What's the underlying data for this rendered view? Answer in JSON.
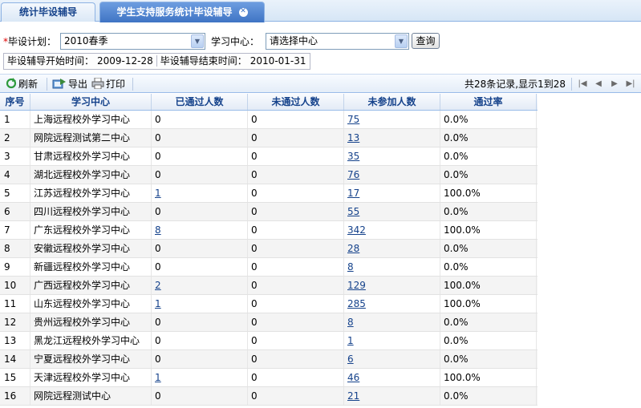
{
  "tabs": [
    {
      "label": "统计毕设辅导",
      "active": false
    },
    {
      "label": "学生支持服务统计毕设辅导",
      "active": true
    }
  ],
  "filters": {
    "plan_required_mark": "*",
    "plan_label": "毕设计划：",
    "plan_value": "2010春季",
    "center_label": "学习中心：",
    "center_value": "请选择中心",
    "query_button": "查询"
  },
  "dates": {
    "start_label": "毕设辅导开始时间：",
    "start_value": "2009-12-28",
    "end_label": "毕设辅导结束时间：",
    "end_value": "2010-01-31"
  },
  "toolbar": {
    "refresh": "刷新",
    "export": "导出",
    "print": "打印",
    "pager_info": "共28条记录,显示1到28"
  },
  "grid": {
    "columns": [
      "序号",
      "学习中心",
      "已通过人数",
      "未通过人数",
      "未参加人数",
      "通过率"
    ],
    "rows": [
      {
        "no": "1",
        "center": "上海远程校外学习中心",
        "passed": "0",
        "failed": "0",
        "absent": "75",
        "rate": "0.0%"
      },
      {
        "no": "2",
        "center": "网院远程测试第二中心",
        "passed": "0",
        "failed": "0",
        "absent": "13",
        "rate": "0.0%"
      },
      {
        "no": "3",
        "center": "甘肃远程校外学习中心",
        "passed": "0",
        "failed": "0",
        "absent": "35",
        "rate": "0.0%"
      },
      {
        "no": "4",
        "center": "湖北远程校外学习中心",
        "passed": "0",
        "failed": "0",
        "absent": "76",
        "rate": "0.0%"
      },
      {
        "no": "5",
        "center": "江苏远程校外学习中心",
        "passed": "1",
        "failed": "0",
        "absent": "17",
        "rate": "100.0%"
      },
      {
        "no": "6",
        "center": "四川远程校外学习中心",
        "passed": "0",
        "failed": "0",
        "absent": "55",
        "rate": "0.0%"
      },
      {
        "no": "7",
        "center": "广东远程校外学习中心",
        "passed": "8",
        "failed": "0",
        "absent": "342",
        "rate": "100.0%"
      },
      {
        "no": "8",
        "center": "安徽远程校外学习中心",
        "passed": "0",
        "failed": "0",
        "absent": "28",
        "rate": "0.0%"
      },
      {
        "no": "9",
        "center": "新疆远程校外学习中心",
        "passed": "0",
        "failed": "0",
        "absent": "8",
        "rate": "0.0%"
      },
      {
        "no": "10",
        "center": "广西远程校外学习中心",
        "passed": "2",
        "failed": "0",
        "absent": "129",
        "rate": "100.0%"
      },
      {
        "no": "11",
        "center": "山东远程校外学习中心",
        "passed": "1",
        "failed": "0",
        "absent": "285",
        "rate": "100.0%"
      },
      {
        "no": "12",
        "center": "贵州远程校外学习中心",
        "passed": "0",
        "failed": "0",
        "absent": "8",
        "rate": "0.0%"
      },
      {
        "no": "13",
        "center": "黑龙江远程校外学习中心",
        "passed": "0",
        "failed": "0",
        "absent": "1",
        "rate": "0.0%"
      },
      {
        "no": "14",
        "center": "宁夏远程校外学习中心",
        "passed": "0",
        "failed": "0",
        "absent": "6",
        "rate": "0.0%"
      },
      {
        "no": "15",
        "center": "天津远程校外学习中心",
        "passed": "1",
        "failed": "0",
        "absent": "46",
        "rate": "100.0%"
      },
      {
        "no": "16",
        "center": "网院远程测试中心",
        "passed": "0",
        "failed": "0",
        "absent": "21",
        "rate": "0.0%"
      }
    ]
  },
  "icons": {
    "refresh": "refresh-icon",
    "export": "export-icon",
    "print": "printer-icon",
    "close_tab": "close-icon"
  },
  "colors": {
    "link": "#15428b",
    "header_text": "#15428b",
    "active_tab": "#3f74c4",
    "required": "#e00000"
  }
}
